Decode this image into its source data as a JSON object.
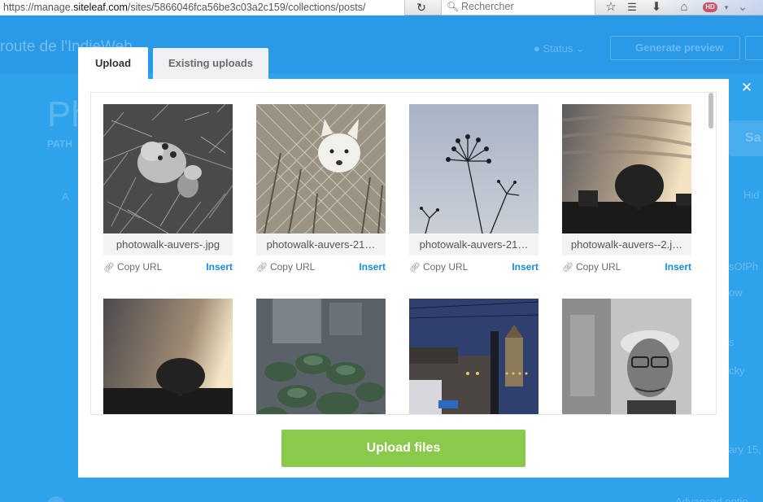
{
  "browser": {
    "url_prefix": "https://manage.",
    "url_domain": "siteleaf.com",
    "url_path": "/sites/5866046fca56be3c03a2c159/collections/posts/",
    "search_placeholder": "Rechercher",
    "hd_badge": "HD"
  },
  "background": {
    "site_title": "route de l'IndieWeb",
    "status_label": "Status",
    "preview_label": "Generate preview",
    "page_title": "Ph",
    "path_label": "PATH",
    "a_label": "A",
    "save_label": "Sa",
    "hide_label": "Hid",
    "tag_label": "sOfPh",
    "show_label": "ow",
    "s_label": "s",
    "cky_label": "cky",
    "date_label": "ary 15, ",
    "advanced_label": "Advanced optio"
  },
  "modal": {
    "tabs": [
      {
        "label": "Upload",
        "active": true
      },
      {
        "label": "Existing uploads",
        "active": false
      }
    ],
    "close_icon": "close-icon",
    "copy_url_label": "Copy URL",
    "insert_label": "Insert",
    "upload_button_label": "Upload files",
    "files": [
      {
        "filename": "photowalk-auvers-.jpg"
      },
      {
        "filename": "photowalk-auvers-21…"
      },
      {
        "filename": "photowalk-auvers-21…"
      },
      {
        "filename": "photowalk-auvers--2.j…"
      },
      {
        "filename": ""
      },
      {
        "filename": ""
      },
      {
        "filename": ""
      },
      {
        "filename": ""
      }
    ]
  },
  "colors": {
    "page_blue": "#2d9ee8",
    "insert_blue": "#1a8ee0",
    "upload_green": "#8bc94a"
  }
}
